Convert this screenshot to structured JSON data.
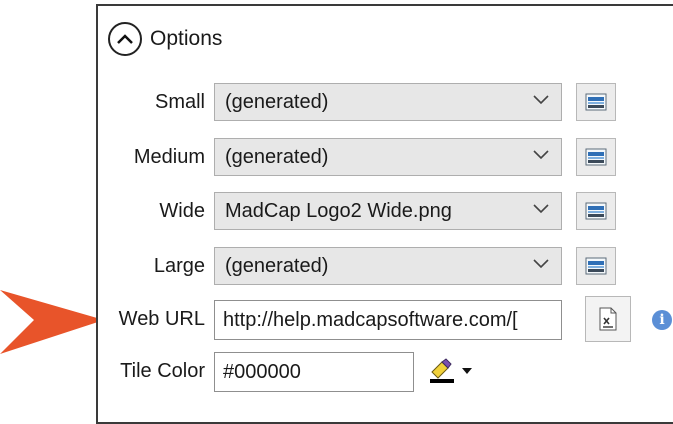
{
  "options": {
    "label": "Options"
  },
  "fields": [
    {
      "label": "Small",
      "value": "(generated)"
    },
    {
      "label": "Medium",
      "value": "(generated)"
    },
    {
      "label": "Wide",
      "value": "MadCap Logo2 Wide.png"
    },
    {
      "label": "Large",
      "value": "(generated)"
    }
  ],
  "web_url": {
    "label": "Web URL",
    "value": "http://help.madcapsoftware.com/["
  },
  "tile_color": {
    "label": "Tile Color",
    "value": "#000000"
  },
  "info": {
    "glyph": "i"
  },
  "colors": {
    "arrow": "#e8542a",
    "info": "#5b8fd6"
  }
}
